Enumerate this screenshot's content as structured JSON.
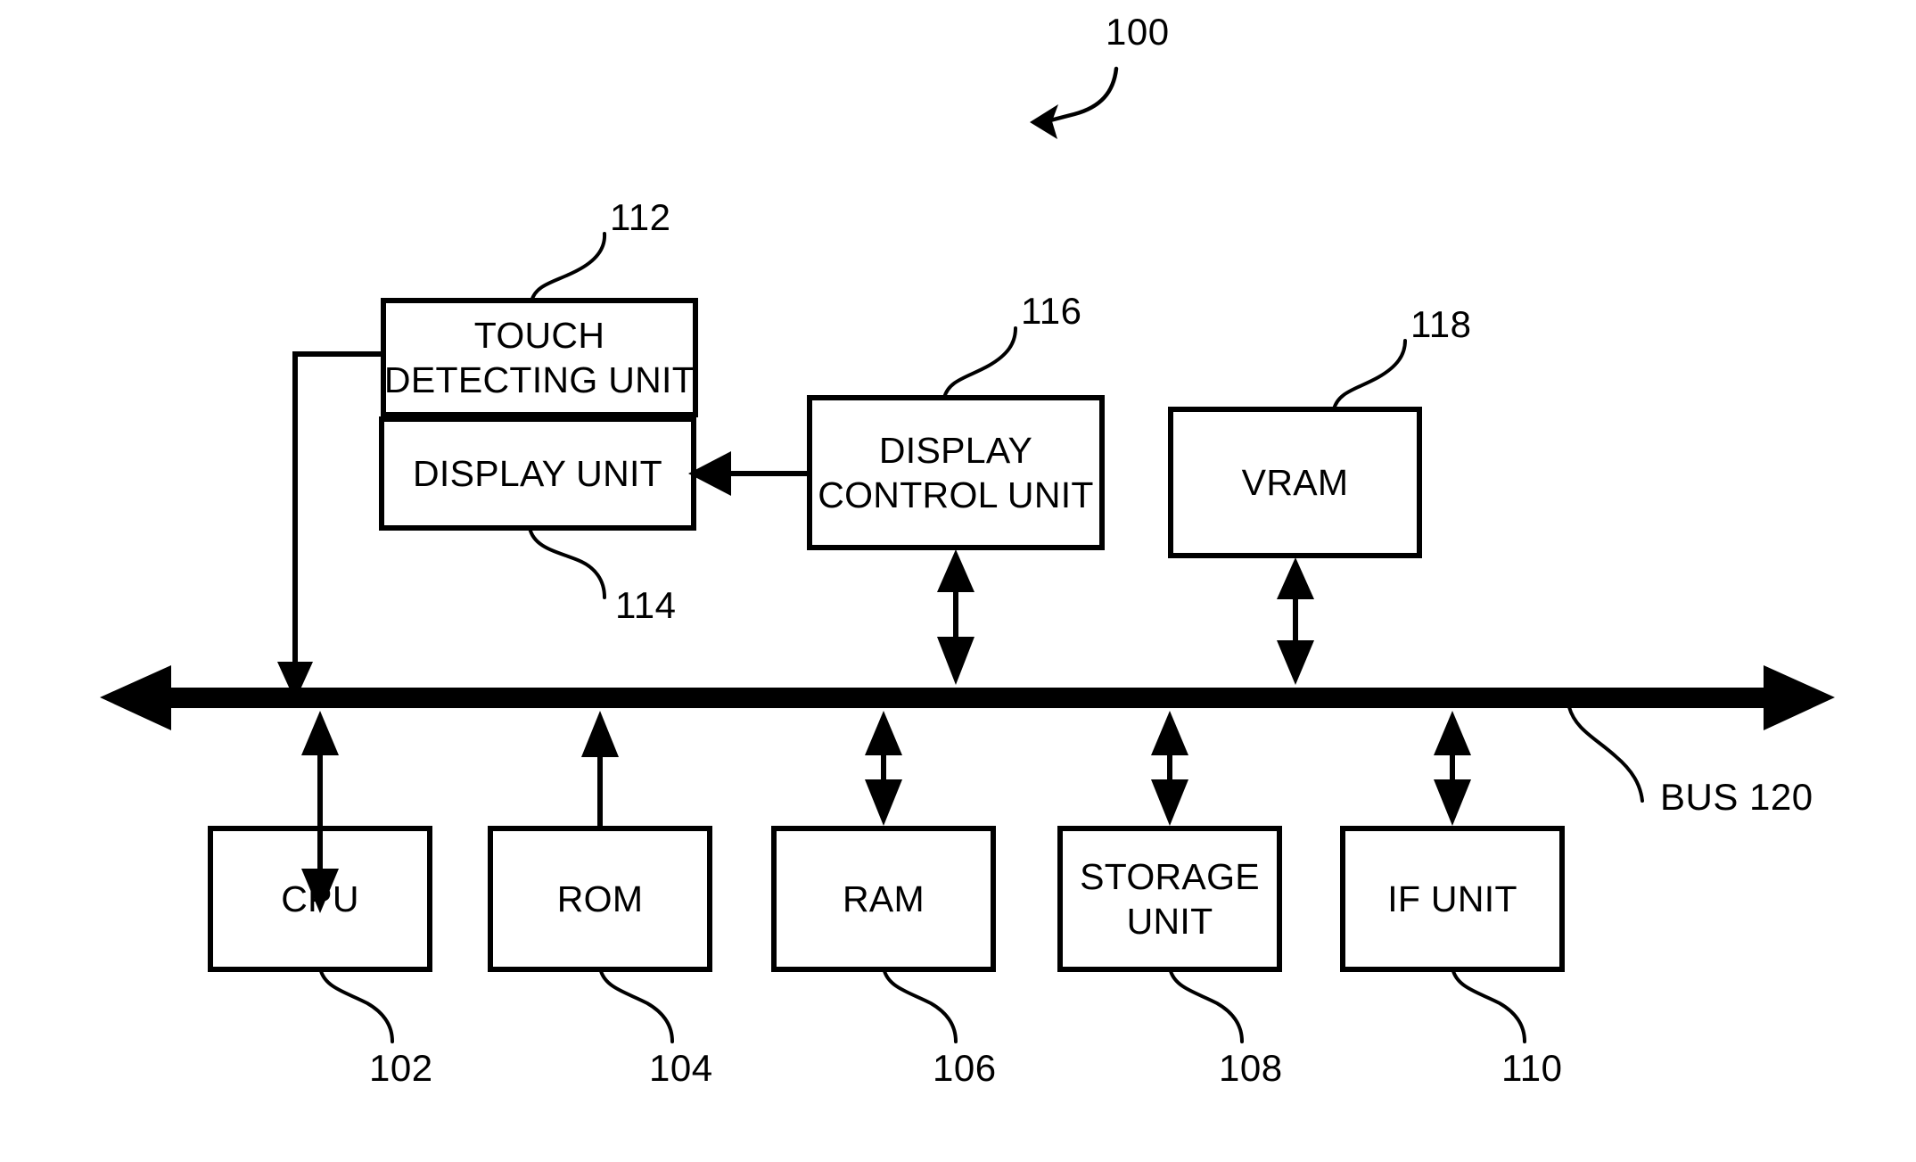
{
  "figure": {
    "id_label": "100",
    "bus_label": "BUS 120"
  },
  "blocks": [
    {
      "key": "touch_detecting_unit",
      "label": "TOUCH\nDETECTING UNIT",
      "ref": "112"
    },
    {
      "key": "display_unit",
      "label": "DISPLAY UNIT",
      "ref": "114"
    },
    {
      "key": "display_control_unit",
      "label": "DISPLAY\nCONTROL UNIT",
      "ref": "116"
    },
    {
      "key": "vram",
      "label": "VRAM",
      "ref": "118"
    },
    {
      "key": "cpu",
      "label": "CPU",
      "ref": "102"
    },
    {
      "key": "rom",
      "label": "ROM",
      "ref": "104"
    },
    {
      "key": "ram",
      "label": "RAM",
      "ref": "106"
    },
    {
      "key": "storage_unit",
      "label": "STORAGE\nUNIT",
      "ref": "108"
    },
    {
      "key": "if_unit",
      "label": "IF UNIT",
      "ref": "110"
    }
  ],
  "colors": {
    "ink": "#000000",
    "paper": "#ffffff"
  }
}
